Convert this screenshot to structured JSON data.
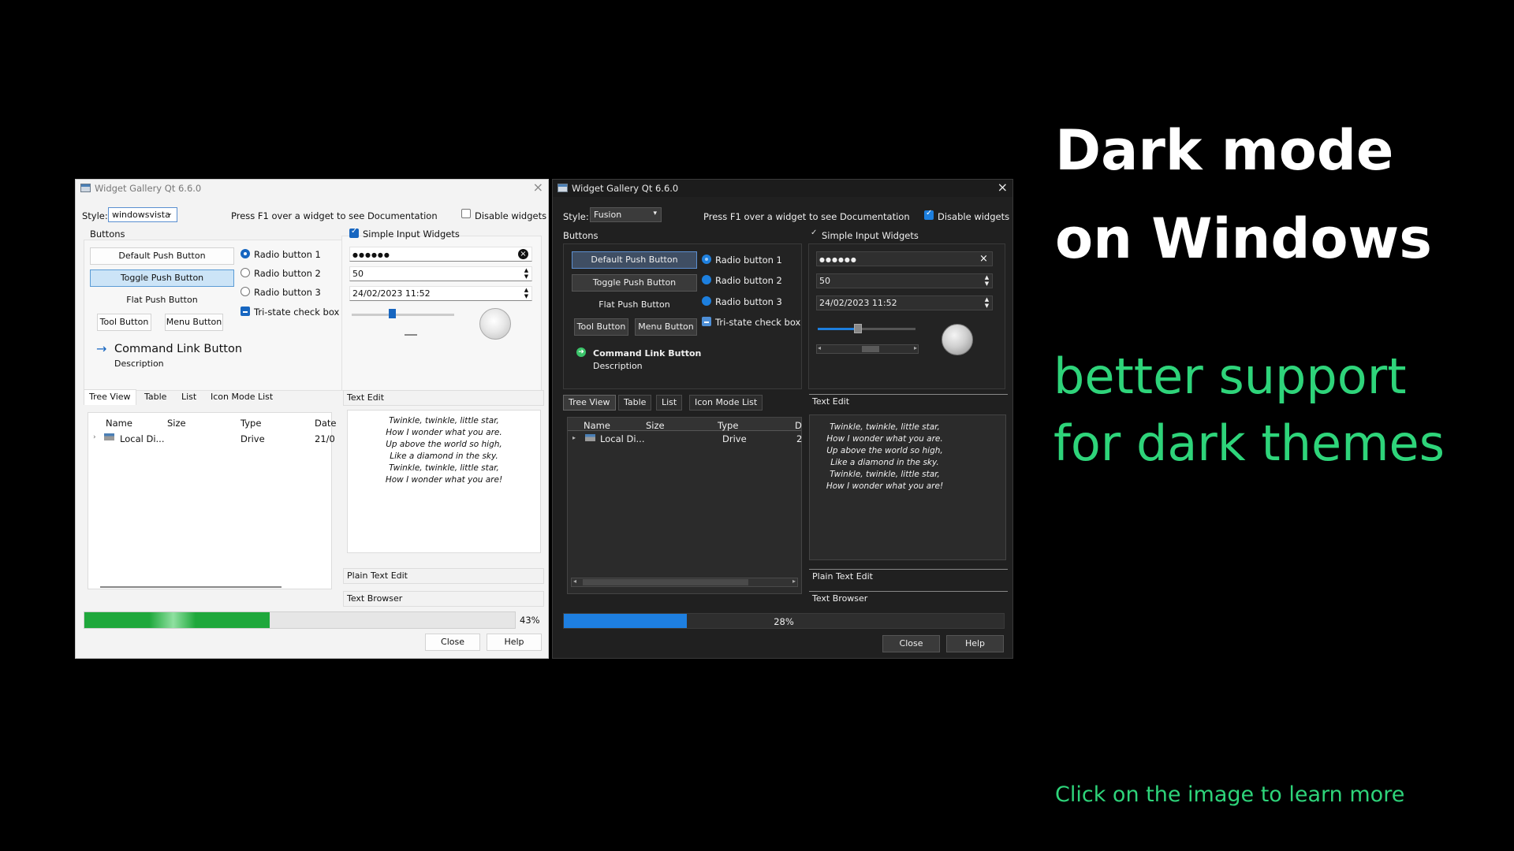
{
  "slide": {
    "heading_line1": "Dark mode",
    "heading_line2": "on Windows",
    "subheading_line1": "better support",
    "subheading_line2": "for dark themes",
    "cta": "Click on the image to learn more",
    "colors": {
      "accent_green": "#2ed47a",
      "background": "#000000"
    }
  },
  "light_window": {
    "title": "Widget Gallery Qt 6.6.0",
    "style_label": "Style:",
    "style_value": "windowsvista",
    "help_text": "Press F1 over a widget to see Documentation",
    "disable_widgets": "Disable widgets",
    "buttons_group": "Buttons",
    "default_push": "Default Push Button",
    "toggle_push": "Toggle Push Button",
    "flat_push": "Flat Push Button",
    "tool_button": "Tool Button",
    "menu_button": "Menu Button",
    "command_link": "Command Link Button",
    "command_desc": "Description",
    "radio1": "Radio button 1",
    "radio2": "Radio button 2",
    "radio3": "Radio button 3",
    "tristate": "Tri-state check box",
    "simple_input": "Simple Input Widgets",
    "password": "●●●●●●",
    "spin_value": "50",
    "datetime": "24/02/2023 11:52",
    "tabs": [
      "Tree View",
      "Table",
      "List",
      "Icon Mode List"
    ],
    "tree_headers": [
      "Name",
      "Size",
      "Type",
      "Date"
    ],
    "tree_row": {
      "name": "Local Di...",
      "type": "Drive",
      "date": "21/0"
    },
    "text_edit_label": "Text Edit",
    "plain_text_edit": "Plain Text Edit",
    "text_browser": "Text Browser",
    "progress_label": "43%",
    "progress_value": 0.43,
    "close": "Close",
    "help": "Help",
    "colors": {
      "progress": "#1fa83c",
      "accent": "#1766c0"
    }
  },
  "dark_window": {
    "title": "Widget Gallery Qt 6.6.0",
    "style_label": "Style:",
    "style_value": "Fusion",
    "help_text": "Press F1 over a widget to see Documentation",
    "disable_widgets": "Disable widgets",
    "buttons_group": "Buttons",
    "default_push": "Default Push Button",
    "toggle_push": "Toggle Push Button",
    "flat_push": "Flat Push Button",
    "tool_button": "Tool Button",
    "menu_button": "Menu Button",
    "command_link": "Command Link Button",
    "command_desc": "Description",
    "radio1": "Radio button 1",
    "radio2": "Radio button 2",
    "radio3": "Radio button 3",
    "tristate": "Tri-state check box",
    "simple_input": "Simple Input Widgets",
    "password": "●●●●●●",
    "spin_value": "50",
    "datetime": "24/02/2023 11:52",
    "tabs": [
      "Tree View",
      "Table",
      "List",
      "Icon Mode List"
    ],
    "tree_headers": [
      "Name",
      "Size",
      "Type",
      "D"
    ],
    "tree_row": {
      "name": "Local Di...",
      "type": "Drive",
      "date": "2"
    },
    "text_edit_label": "Text Edit",
    "plain_text_edit": "Plain Text Edit",
    "text_browser": "Text Browser",
    "progress_label": "28%",
    "progress_value": 0.28,
    "close": "Close",
    "help": "Help",
    "colors": {
      "progress": "#1e7fe0",
      "accent": "#1d7fde"
    }
  },
  "poem": [
    "Twinkle, twinkle, little star,",
    "How I wonder what you are.",
    "Up above the world so high,",
    "Like a diamond in the sky.",
    "Twinkle, twinkle, little star,",
    "How I wonder what you are!"
  ]
}
